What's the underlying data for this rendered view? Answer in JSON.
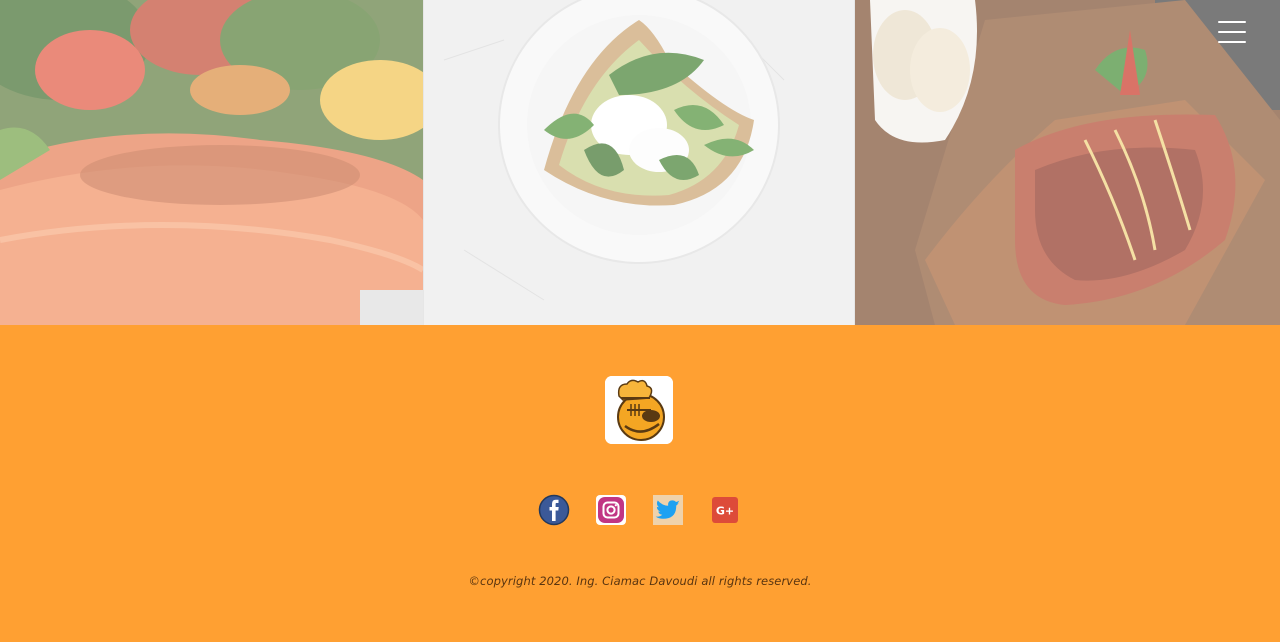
{
  "header": {
    "menu_icon": "hamburger-menu-icon"
  },
  "gallery": {
    "photos": [
      {
        "subject": "grilled-salmon-salad"
      },
      {
        "subject": "avocado-toast-poached-egg-spinach"
      },
      {
        "subject": "bbq-salmon-on-board"
      }
    ]
  },
  "footer": {
    "logo_icon": "chef-smiley-logo-icon",
    "social": [
      {
        "name": "facebook",
        "icon": "facebook-icon",
        "color": "#3b5998"
      },
      {
        "name": "instagram",
        "icon": "instagram-icon",
        "color": "#c13584"
      },
      {
        "name": "twitter",
        "icon": "twitter-icon",
        "color": "#1da1f2"
      },
      {
        "name": "google-plus",
        "icon": "google-plus-icon",
        "color": "#dd4b39"
      }
    ],
    "copyright": "©copyright 2020. Ing. Ciamac Davoudi all rights reserved.",
    "background_color": "#ffa032"
  }
}
